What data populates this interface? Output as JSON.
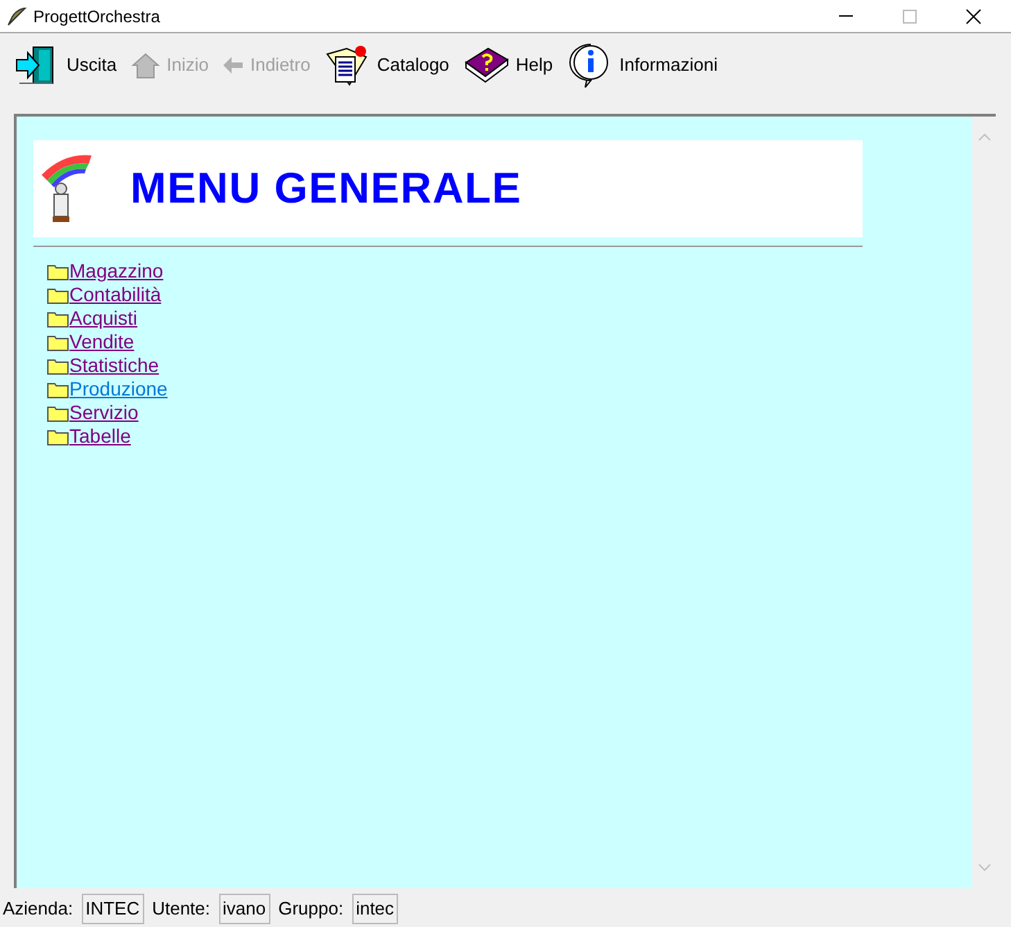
{
  "window": {
    "title": "ProgettOrchestra"
  },
  "toolbar": [
    {
      "label": "Uscita",
      "kind": "exit",
      "disabled": false
    },
    {
      "label": "Inizio",
      "kind": "home",
      "disabled": true
    },
    {
      "label": "Indietro",
      "kind": "back",
      "disabled": true
    },
    {
      "label": "Catalogo",
      "kind": "catalog",
      "disabled": false
    },
    {
      "label": "Help",
      "kind": "help",
      "disabled": false
    },
    {
      "label": "Informazioni",
      "kind": "info",
      "disabled": false
    }
  ],
  "page": {
    "heading": "MENU GENERALE",
    "links": [
      {
        "label": "Magazzino",
        "visited": true
      },
      {
        "label": "Contabilità",
        "visited": true
      },
      {
        "label": "Acquisti",
        "visited": true
      },
      {
        "label": "Vendite",
        "visited": true
      },
      {
        "label": "Statistiche",
        "visited": true
      },
      {
        "label": "Produzione",
        "visited": false
      },
      {
        "label": "Servizio",
        "visited": true
      },
      {
        "label": "Tabelle",
        "visited": true
      }
    ]
  },
  "status_bar": [
    {
      "label": "Azienda:",
      "value": "INTEC"
    },
    {
      "label": "Utente:",
      "value": "ivano"
    },
    {
      "label": "Gruppo:",
      "value": "intec"
    }
  ]
}
